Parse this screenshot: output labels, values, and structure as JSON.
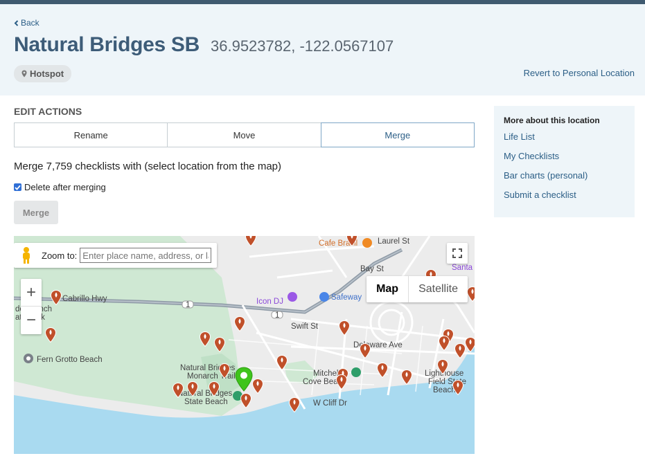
{
  "nav": {
    "back_label": "Back"
  },
  "location": {
    "name": "Natural Bridges SB",
    "coords": "36.9523782, -122.0567107",
    "badge": "Hotspot",
    "revert_label": "Revert to Personal Location"
  },
  "edit": {
    "title": "EDIT ACTIONS",
    "tabs": [
      {
        "label": "Rename",
        "active": false
      },
      {
        "label": "Move",
        "active": false
      },
      {
        "label": "Merge",
        "active": true
      }
    ],
    "merge_description": "Merge 7,759 checklists with (select location from the map)",
    "delete_label": "Delete after merging",
    "delete_checked": true,
    "merge_button": "Merge"
  },
  "sidebar": {
    "title": "More about this location",
    "links": [
      "Life List",
      "My Checklists",
      "Bar charts (personal)",
      "Submit a checklist"
    ]
  },
  "map": {
    "zoom_to_label": "Zoom to:",
    "zoom_to_placeholder": "Enter place name, address, or lat/lo",
    "map_type_options": [
      "Map",
      "Satellite"
    ],
    "map_type_selected": "Map",
    "labels": {
      "cafe": "Cafe Brasil",
      "laurel": "Laurel St",
      "bay": "Bay St",
      "santa": "Santa",
      "cabrillo": "Cabrillo Hwy",
      "wilder1": "der Ranch",
      "wilder2": "ate Park",
      "hwy1a": "1",
      "hwy1b": "1",
      "icondj": "Icon DJ",
      "safeway": "Safeway",
      "swift": "Swift St",
      "delaware": "Delaware Ave",
      "fern": "Fern Grotto Beach",
      "nb1": "Natural Bridges",
      "nb2": "Monarch Trail",
      "nbs1": "Natural Bridges",
      "nbs2": "State Beach",
      "mitchell1": "Mitchell's",
      "mitchell2": "Cove Beach",
      "wcliff": "W Cliff Dr",
      "light1": "Lighthouse",
      "light2": "Field State",
      "light3": "Beach"
    },
    "colors": {
      "hotspot_pin": "#c0502a",
      "selected_pin": "#3fc41c",
      "water": "#a9daf0",
      "park": "#cfe8d3"
    }
  }
}
